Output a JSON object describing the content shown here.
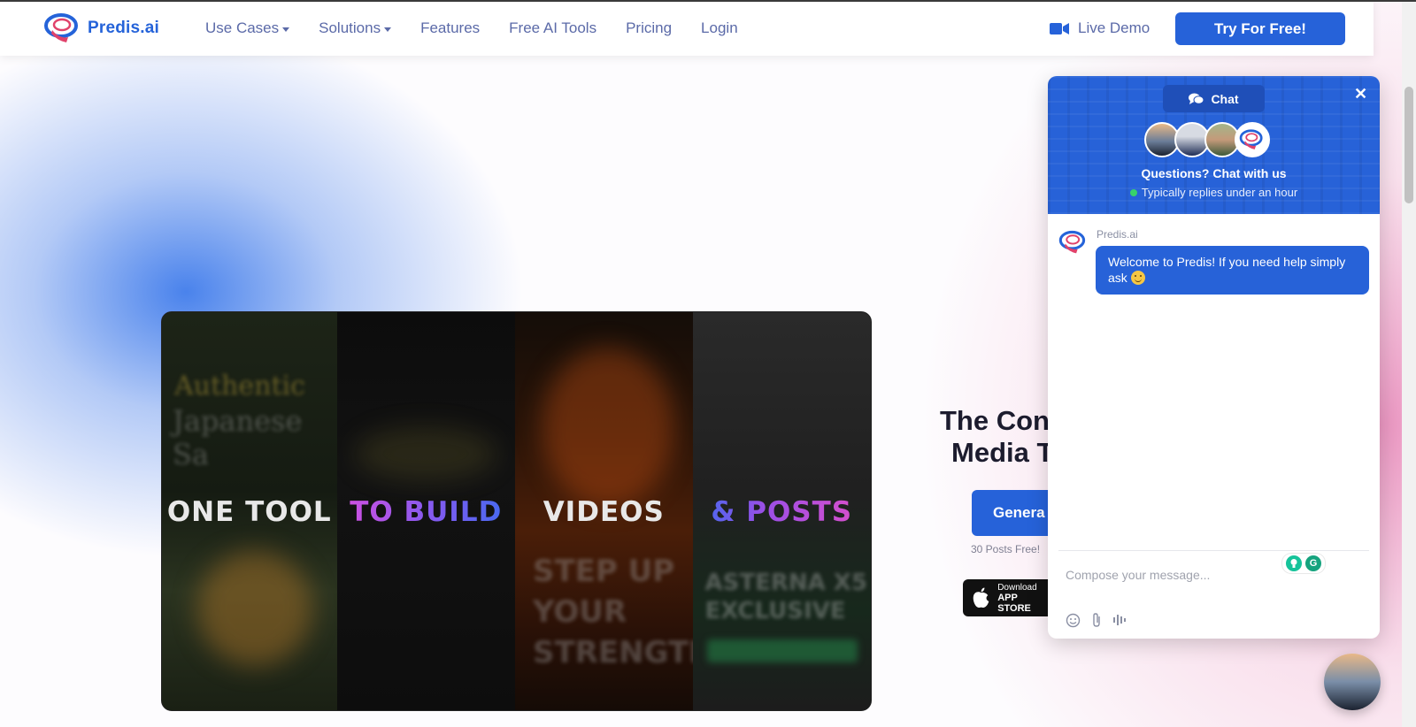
{
  "brand": {
    "name": "Predis.ai",
    "accent": "#2662d9"
  },
  "nav": {
    "links": [
      {
        "label": "Use Cases",
        "dropdown": true
      },
      {
        "label": "Solutions",
        "dropdown": true
      },
      {
        "label": "Features",
        "dropdown": false
      },
      {
        "label": "Free AI Tools",
        "dropdown": false
      },
      {
        "label": "Pricing",
        "dropdown": false
      },
      {
        "label": "Login",
        "dropdown": false
      }
    ],
    "live_demo": "Live Demo",
    "cta": "Try For Free!"
  },
  "video": {
    "captions": [
      "ONE TOOL",
      "TO BUILD",
      "VIDEOS",
      "& POSTS"
    ]
  },
  "hero": {
    "title_line1": "The Con",
    "title_line2": "Media T",
    "generate_button": "Genera",
    "posts_free": "30 Posts Free!",
    "appstore_line1": "Download",
    "appstore_line2": "APP STORE"
  },
  "chat": {
    "tab_label": "Chat",
    "close_icon": "close-icon",
    "heading": "Questions? Chat with us",
    "reply_status": "Typically replies under an hour",
    "status_color": "#37d26b",
    "sender": "Predis.ai",
    "welcome_message": "Welcome to Predis! If you need help simply ask",
    "compose_placeholder": "Compose your message..."
  }
}
